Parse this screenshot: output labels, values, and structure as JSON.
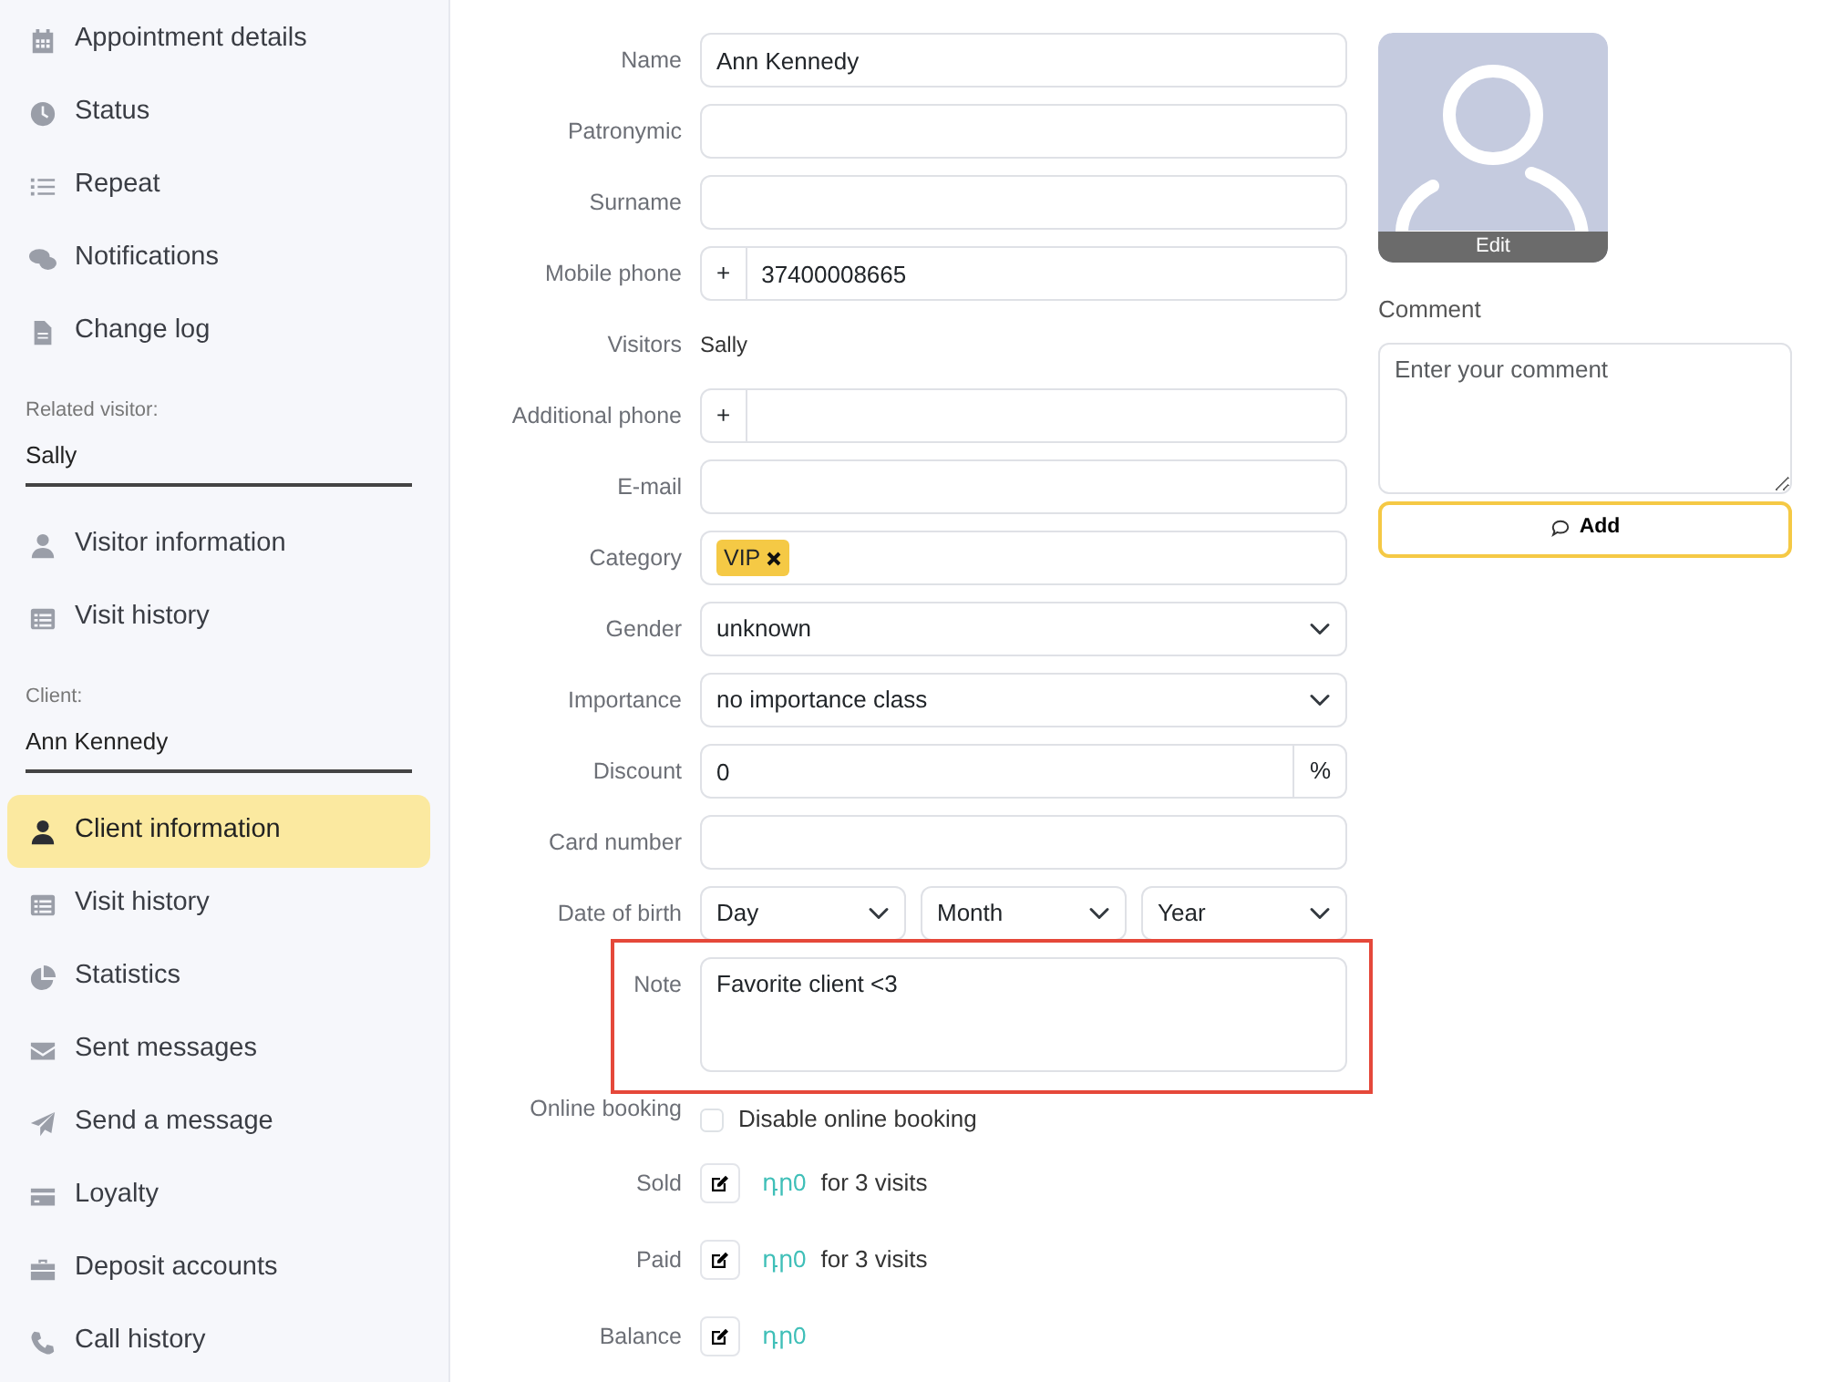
{
  "sidebar": {
    "sections": [
      {
        "items": [
          {
            "label": "Appointment details",
            "selected": false
          },
          {
            "label": "Status",
            "selected": false
          },
          {
            "label": "Repeat",
            "selected": false
          },
          {
            "label": "Notifications",
            "selected": false
          },
          {
            "label": "Change log",
            "selected": false
          }
        ]
      },
      {
        "label": "Related visitor:",
        "value": "Sally",
        "items": [
          {
            "label": "Visitor information",
            "selected": false
          },
          {
            "label": "Visit history",
            "selected": false
          }
        ]
      },
      {
        "label": "Client:",
        "value": "Ann Kennedy",
        "items": [
          {
            "label": "Client information",
            "selected": true
          },
          {
            "label": "Visit history",
            "selected": false
          },
          {
            "label": "Statistics",
            "selected": false
          },
          {
            "label": "Sent messages",
            "selected": false
          },
          {
            "label": "Send a message",
            "selected": false
          },
          {
            "label": "Loyalty",
            "selected": false
          },
          {
            "label": "Deposit accounts",
            "selected": false
          },
          {
            "label": "Call history",
            "selected": false
          }
        ]
      }
    ]
  },
  "form": {
    "fields": [
      {
        "kind": "text",
        "label": "Name",
        "value": "Ann Kennedy"
      },
      {
        "kind": "text",
        "label": "Patronymic"
      },
      {
        "kind": "text",
        "label": "Surname"
      },
      {
        "kind": "phone",
        "label": "Mobile phone",
        "prefix": "+",
        "value": "37400008665"
      },
      {
        "kind": "static",
        "label": "Visitors",
        "value": "Sally"
      },
      {
        "kind": "phone",
        "label": "Additional phone",
        "prefix": "+"
      },
      {
        "kind": "text",
        "label": "E-mail"
      },
      {
        "kind": "tags",
        "label": "Category",
        "tags": [
          "VIP"
        ]
      },
      {
        "kind": "select",
        "label": "Gender",
        "value": "unknown"
      },
      {
        "kind": "select",
        "label": "Importance",
        "value": "no importance class"
      },
      {
        "kind": "suffix",
        "label": "Discount",
        "value": "0",
        "suffix": "%"
      },
      {
        "kind": "text",
        "label": "Card number"
      },
      {
        "kind": "date",
        "label": "Date of birth",
        "parts": [
          "Day",
          "Month",
          "Year"
        ]
      },
      {
        "kind": "textarea",
        "label": "Note",
        "value": "Favorite client <3",
        "highlighted": true
      },
      {
        "kind": "checkbox",
        "label": "Online booking",
        "text": "Disable online booking",
        "checked": false
      },
      {
        "kind": "amount",
        "label": "Sold",
        "amount": "դր0",
        "text": "for 3 visits"
      },
      {
        "kind": "amount",
        "label": "Paid",
        "amount": "դր0",
        "text": "for 3 visits"
      },
      {
        "kind": "amount",
        "label": "Balance",
        "amount": "դր0"
      }
    ]
  },
  "profile": {
    "photo_button": "Edit",
    "comment_label": "Comment",
    "comment_placeholder": "Enter your comment",
    "add_button": "Add"
  }
}
